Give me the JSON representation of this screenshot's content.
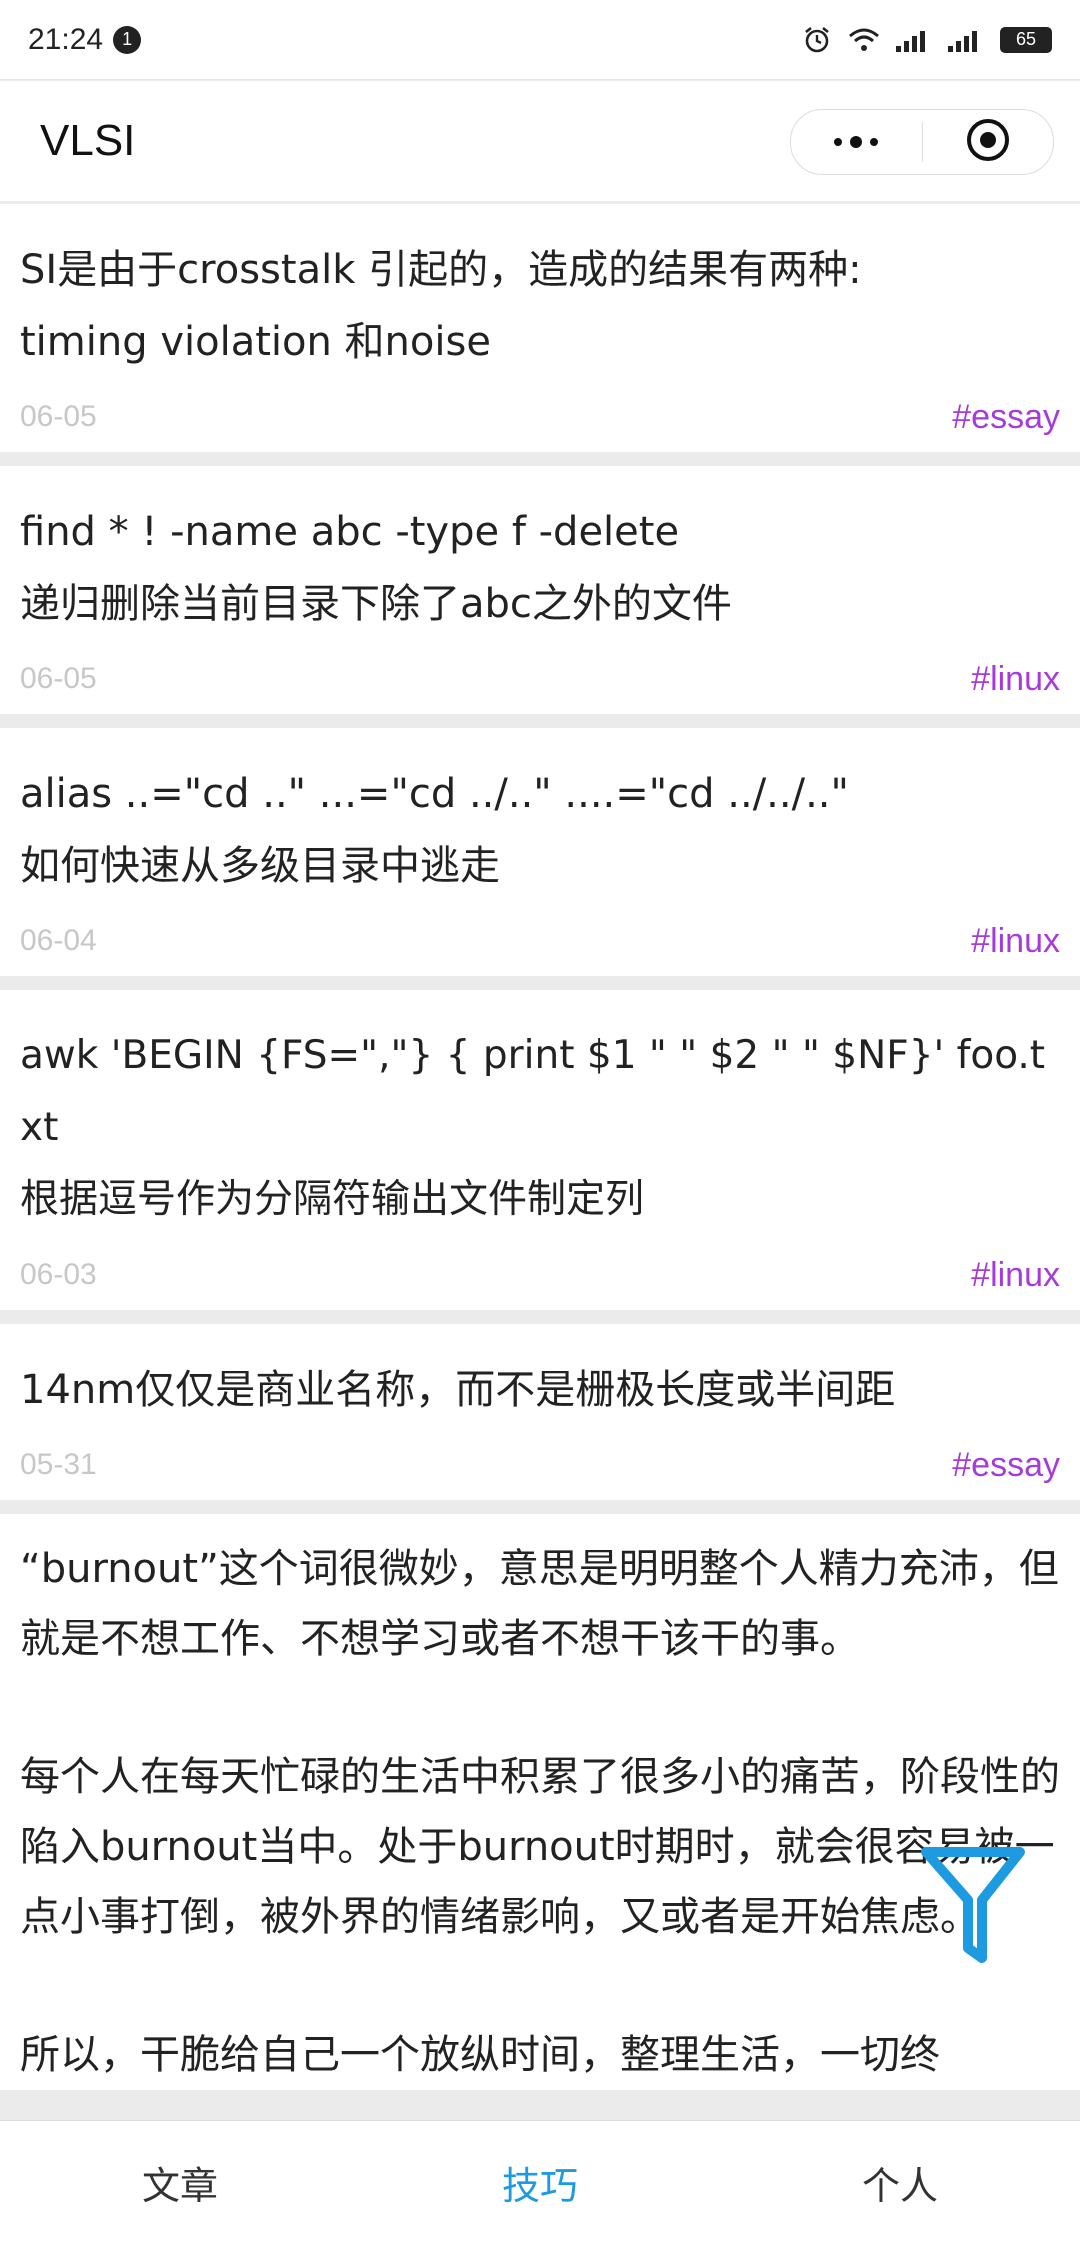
{
  "status_bar": {
    "time": "21:24",
    "notification_count": "1",
    "battery": "65",
    "icons": [
      "alarm-icon",
      "wifi-icon",
      "signal-icon",
      "signal-icon"
    ]
  },
  "nav": {
    "title": "VLSI",
    "menu_icon": "more-dots-icon",
    "close_icon": "target-circle-icon"
  },
  "cards": [
    {
      "text": "SI是由于crosstalk 引起的，造成的结果有两种:\ntiming violation 和noise",
      "date": "06-05",
      "tag": "#essay"
    },
    {
      "text": "find * ! -name abc -type f -delete\n递归删除当前目录下除了abc之外的文件",
      "date": "06-05",
      "tag": "#linux"
    },
    {
      "text": "alias ..=\"cd ..\" ...=\"cd ../..\" ....=\"cd ../../..\"\n如何快速从多级目录中逃走",
      "date": "06-04",
      "tag": "#linux"
    },
    {
      "text": "awk 'BEGIN {FS=\",\"} { print $1 \" \" $2 \" \" $NF}' foo.txt\n根据逗号作为分隔符输出文件制定列",
      "date": "06-03",
      "tag": "#linux"
    },
    {
      "text": "14nm仅仅是商业名称，而不是栅极长度或半间距",
      "date": "05-31",
      "tag": "#essay"
    }
  ],
  "long_card": {
    "p1": "“burnout”这个词很微妙，意思是明明整个人精力充沛，但就是不想工作、不想学习或者不想干该干的事。",
    "p2": "每个人在每天忙碌的生活中积累了很多小的痛苦，阶段性的陷入burnout当中。处于burnout时期时，就会很容易被一点小事打倒，被外界的情绪影响，又或者是开始焦虑。",
    "p3": "所以，干脆给自己一个放纵时间，整理生活，一切终"
  },
  "fab": {
    "icon": "filter-funnel-icon",
    "color": "#1e9ae0"
  },
  "tabs": [
    {
      "label": "文章",
      "active": false
    },
    {
      "label": "技巧",
      "active": true
    },
    {
      "label": "个人",
      "active": false
    }
  ],
  "colors": {
    "tag": "#a63bd9",
    "active_tab": "#1e9ae0",
    "date": "#c7c7c7"
  }
}
